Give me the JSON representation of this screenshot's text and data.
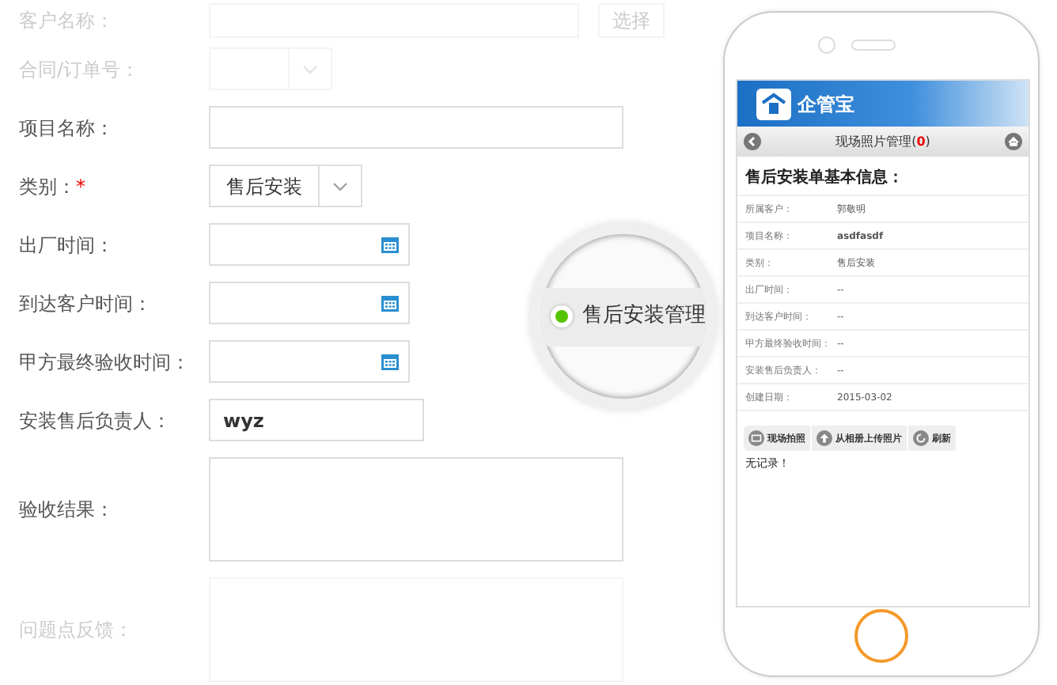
{
  "form": {
    "fields": [
      {
        "kind": "search",
        "label": "客户名称：",
        "faded": true,
        "button": "选择"
      },
      {
        "kind": "select",
        "label": "合同/订单号：",
        "faded": true
      },
      {
        "kind": "text",
        "label": "项目名称：",
        "faded": false
      },
      {
        "kind": "select",
        "label": "类别：",
        "required_mark": "*",
        "faded": false,
        "value": "售后安装"
      },
      {
        "kind": "date",
        "label": "出厂时间：",
        "faded": false
      },
      {
        "kind": "date",
        "label": "到达客户时间：",
        "faded": false
      },
      {
        "kind": "date",
        "label": "甲方最终验收时间：",
        "faded": false
      },
      {
        "kind": "short",
        "label": "安装售后负责人：",
        "faded": false,
        "value": "wyz"
      },
      {
        "kind": "textarea",
        "label": "验收结果：",
        "faded": false
      },
      {
        "kind": "textarea",
        "label": "问题点反馈：",
        "faded": true
      }
    ]
  },
  "magnifier": {
    "label": "售后安装管理"
  },
  "phone": {
    "logo": "企管宝",
    "nav_title": "现场照片管理(",
    "count": "0",
    "nav_title_end": ")",
    "section_title": "售后安装单基本信息：",
    "rows": [
      {
        "label": "所属客户：",
        "value": "郭敬明"
      },
      {
        "label": "项目名称：",
        "value": "**asdfasdf**"
      },
      {
        "label": "类别：",
        "value": "售后安装"
      },
      {
        "label": "出厂时间：",
        "value": "--"
      },
      {
        "label": "到达客户时间：",
        "value": "--"
      },
      {
        "label": "甲方最终验收时间：",
        "value": "--"
      },
      {
        "label": "安装售后负责人：",
        "value": "--"
      },
      {
        "label": "创建日期：",
        "value": "2015-03-02"
      }
    ],
    "buttons": [
      {
        "kind": "camera",
        "label": "现场拍照"
      },
      {
        "kind": "upload",
        "label": "从相册上传照片"
      },
      {
        "kind": "refresh",
        "label": "刷新"
      }
    ],
    "empty_text": "无记录！"
  }
}
